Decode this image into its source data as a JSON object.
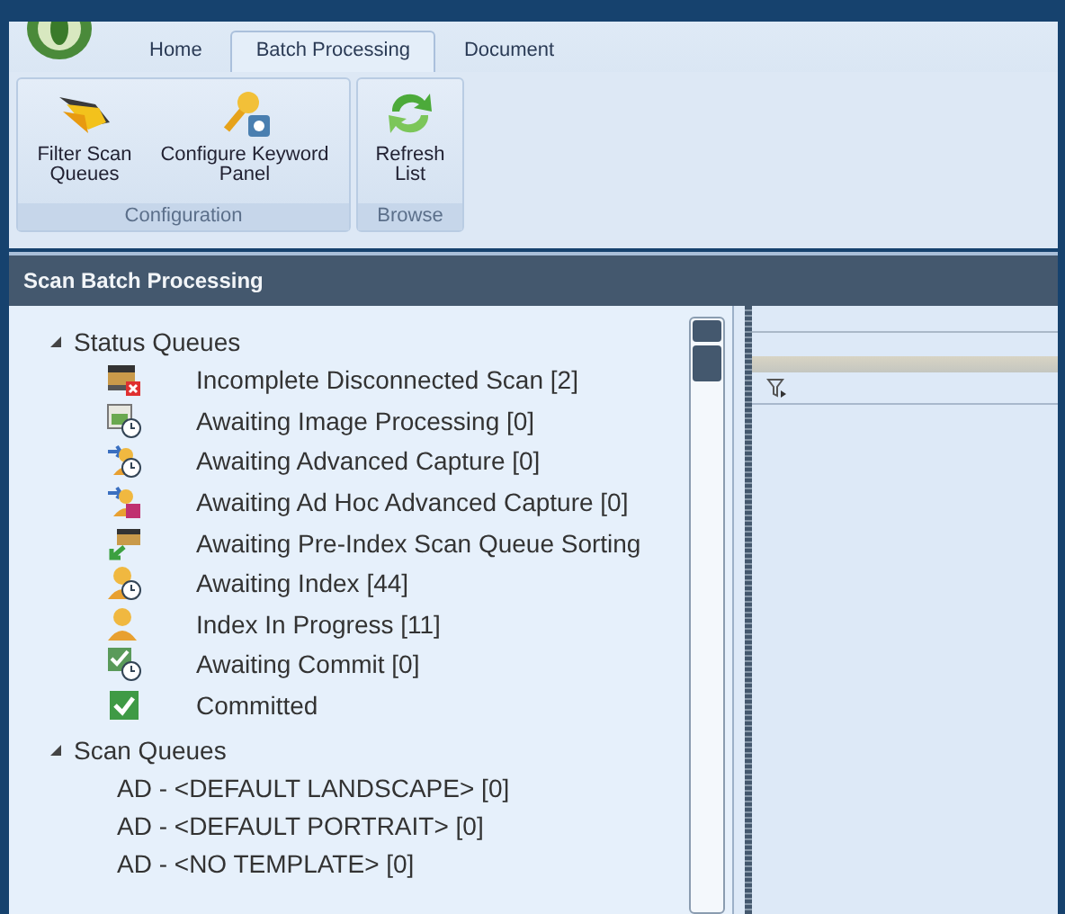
{
  "tabs": [
    {
      "label": "Home",
      "selected": false
    },
    {
      "label": "Batch Processing",
      "selected": true
    },
    {
      "label": "Document",
      "selected": false
    }
  ],
  "ribbon_groups": [
    {
      "label": "Configuration",
      "buttons": [
        {
          "label": "Filter Scan Queues"
        },
        {
          "label": "Configure Keyword Panel"
        }
      ]
    },
    {
      "label": "Browse",
      "buttons": [
        {
          "label": "Refresh List"
        }
      ]
    }
  ],
  "panel": {
    "title": "Scan Batch Processing"
  },
  "tree": [
    {
      "label": "Status Queues",
      "expanded": true,
      "children": [
        {
          "label": "Incomplete Disconnected Scan [2]"
        },
        {
          "label": "Awaiting Image Processing [0]"
        },
        {
          "label": "Awaiting Advanced Capture [0]"
        },
        {
          "label": "Awaiting Ad Hoc Advanced Capture [0]"
        },
        {
          "label": "Awaiting Pre-Index Scan Queue Sorting"
        },
        {
          "label": "Awaiting Index [44]"
        },
        {
          "label": "Index In Progress [11]"
        },
        {
          "label": "Awaiting Commit [0]"
        },
        {
          "label": "Committed"
        }
      ]
    },
    {
      "label": "Scan Queues",
      "expanded": true,
      "children": [
        {
          "label": "AD - <DEFAULT LANDSCAPE> [0]"
        },
        {
          "label": "AD - <DEFAULT PORTRAIT> [0]"
        },
        {
          "label": "AD - <NO TEMPLATE> [0]"
        }
      ]
    }
  ]
}
